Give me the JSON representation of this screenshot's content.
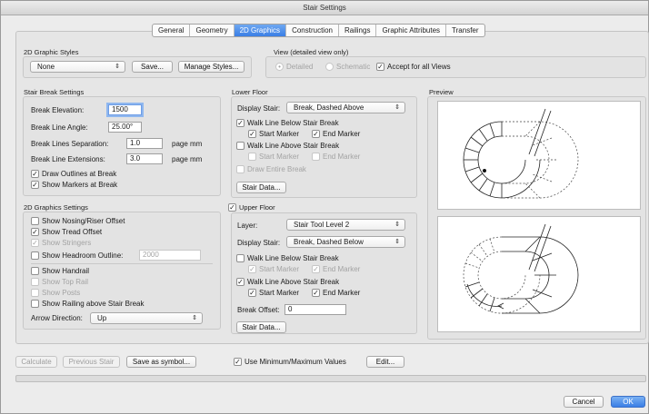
{
  "window": {
    "title": "Stair Settings"
  },
  "tabs": [
    {
      "label": "General"
    },
    {
      "label": "Geometry"
    },
    {
      "label": "2D Graphics"
    },
    {
      "label": "Construction"
    },
    {
      "label": "Railings"
    },
    {
      "label": "Graphic Attributes"
    },
    {
      "label": "Transfer"
    }
  ],
  "graphic_styles": {
    "heading": "2D Graphic Styles",
    "style_value": "None",
    "save_label": "Save...",
    "manage_label": "Manage Styles..."
  },
  "view": {
    "heading": "View (detailed view only)",
    "detailed_label": "Detailed",
    "schematic_label": "Schematic",
    "accept_label": "Accept for all Views"
  },
  "stair_break": {
    "heading": "Stair Break Settings",
    "elevation_label": "Break Elevation:",
    "elevation_value": "1500",
    "angle_label": "Break Line Angle:",
    "angle_value": "25.00°",
    "separation_label": "Break Lines Separation:",
    "separation_value": "1.0",
    "separation_unit": "page mm",
    "extensions_label": "Break Line Extensions:",
    "extensions_value": "3.0",
    "extensions_unit": "page mm",
    "draw_outlines_label": "Draw Outlines at Break",
    "show_markers_label": "Show Markers at Break"
  },
  "graphics_2d": {
    "heading": "2D Graphics Settings",
    "nosing_label": "Show Nosing/Riser Offset",
    "tread_label": "Show Tread Offset",
    "stringers_label": "Show Stringers",
    "headroom_label": "Show Headroom Outline:",
    "headroom_value": "2000",
    "handrail_label": "Show Handrail",
    "toprail_label": "Show Top Rail",
    "posts_label": "Show Posts",
    "railing_label": "Show Railing above Stair Break",
    "arrow_label": "Arrow Direction:",
    "arrow_value": "Up"
  },
  "lower_floor": {
    "heading": "Lower Floor",
    "display_label": "Display Stair:",
    "display_value": "Break, Dashed Above",
    "below_label": "Walk Line Below Stair Break",
    "below_start": "Start Marker",
    "below_end": "End Marker",
    "above_label": "Walk Line Above Stair Break",
    "above_start": "Start Marker",
    "above_end": "End Marker",
    "entire_label": "Draw Entire Break",
    "stair_data_label": "Stair Data..."
  },
  "upper_floor": {
    "heading": "Upper Floor",
    "layer_label": "Layer:",
    "layer_value": "Stair Tool Level 2",
    "display_label": "Display Stair:",
    "display_value": "Break, Dashed Below",
    "below_label": "Walk Line Below Stair Break",
    "below_start": "Start Marker",
    "below_end": "End Marker",
    "above_label": "Walk Line Above Stair Break",
    "above_start": "Start Marker",
    "above_end": "End Marker",
    "offset_label": "Break Offset:",
    "offset_value": "0",
    "stair_data_label": "Stair Data..."
  },
  "preview": {
    "heading": "Preview"
  },
  "footer": {
    "calculate_label": "Calculate",
    "previous_label": "Previous Stair",
    "symbol_label": "Save as symbol...",
    "minmax_label": "Use Minimum/Maximum Values",
    "edit_label": "Edit...",
    "cancel_label": "Cancel",
    "ok_label": "OK"
  },
  "colors": {
    "accent": "#3a7ee5",
    "window": "#ececec"
  }
}
